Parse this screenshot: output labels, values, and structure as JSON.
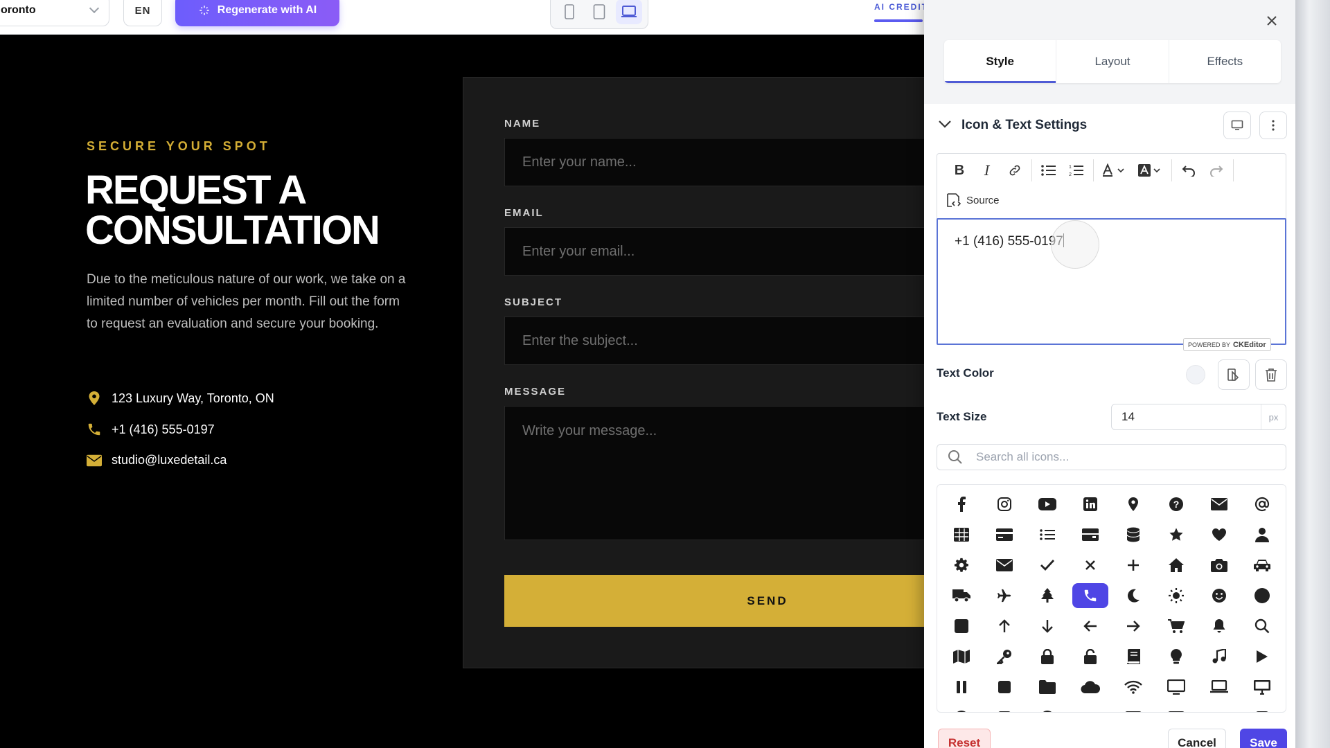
{
  "topbar": {
    "city": "oronto",
    "lang": "EN",
    "regen_label": "Regenerate with AI",
    "ai_credit": "AI CREDIT"
  },
  "preview": {
    "eyebrow": "SECURE YOUR SPOT",
    "headline_line1": "REQUEST A",
    "headline_line2": "CONSULTATION",
    "intro": "Due to the meticulous nature of our work, we take on a limited number of vehicles per month. Fill out the form to request an evaluation and secure your booking.",
    "address": "123 Luxury Way, Toronto, ON",
    "phone": "+1 (416) 555-0197",
    "email": "studio@luxedetail.ca",
    "accent_color": "#d4af37",
    "form": {
      "name_label": "NAME",
      "name_placeholder": "Enter your name...",
      "email_label": "EMAIL",
      "email_placeholder": "Enter your email...",
      "subject_label": "SUBJECT",
      "subject_placeholder": "Enter the subject...",
      "message_label": "MESSAGE",
      "message_placeholder": "Write your message...",
      "send_label": "SEND"
    }
  },
  "panel": {
    "tabs": [
      "Style",
      "Layout",
      "Effects"
    ],
    "active_tab": "Style",
    "section_title": "Icon & Text Settings",
    "source_label": "Source",
    "editor_text": "+1 (416) 555-0197",
    "ck_powered": "POWERED BY",
    "ck_brand": "CKEditor",
    "text_color_label": "Text Color",
    "text_size_label": "Text Size",
    "text_size_value": "14",
    "text_size_unit": "px",
    "icon_search_placeholder": "Search all icons...",
    "selected_icon": "phone-icon",
    "accent_color": "#4f46e5",
    "buttons": {
      "reset": "Reset",
      "cancel": "Cancel",
      "save": "Save"
    }
  }
}
